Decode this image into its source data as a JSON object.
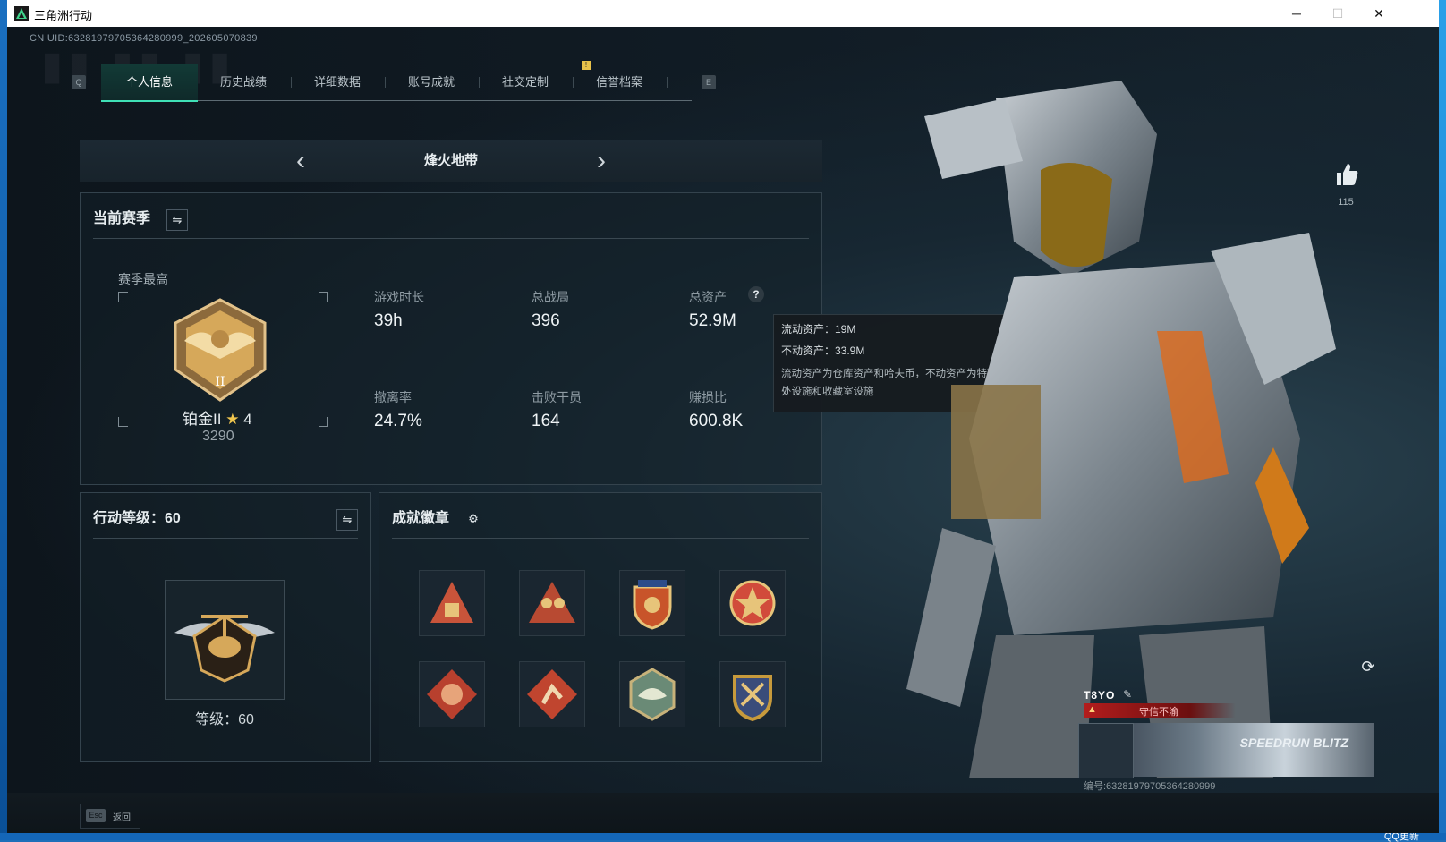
{
  "window": {
    "title": "三角洲行动",
    "controls": {
      "minimize": "─",
      "maximize": "☐",
      "close": "✕"
    }
  },
  "taskbar": {
    "item": "QQ更新"
  },
  "header": {
    "uid": "CN UID:63281979705364280999_202605070839",
    "key_left": "Q",
    "key_right": "E",
    "notif": "!"
  },
  "tabs": [
    {
      "label": "个人信息",
      "active": true
    },
    {
      "label": "历史战绩",
      "active": false
    },
    {
      "label": "详细数据",
      "active": false
    },
    {
      "label": "账号成就",
      "active": false
    },
    {
      "label": "社交定制",
      "active": false
    },
    {
      "label": "信誉档案",
      "active": false
    }
  ],
  "mode_selector": {
    "title": "烽火地带",
    "prev": "‹",
    "next": "›"
  },
  "season": {
    "heading": "当前赛季",
    "swap_icon": "⇋",
    "best_label": "赛季最高",
    "rank_name": "铂金II",
    "rank_star": "★",
    "rank_stars_count": "4",
    "rank_score": "3290",
    "stats": [
      {
        "label": "游戏时长",
        "value": "39h"
      },
      {
        "label": "总战局",
        "value": "396"
      },
      {
        "label": "总资产",
        "value": "52.9M",
        "help": "?"
      },
      {
        "label": "撤离率",
        "value": "24.7%"
      },
      {
        "label": "击败干员",
        "value": "164"
      },
      {
        "label": "赚损比",
        "value": "600.8K"
      }
    ]
  },
  "asset_tooltip": {
    "liquid": "流动资产：19M",
    "fixed": "不动资产：33.9M",
    "desc": "流动资产为仓库资产和哈夫币，不动资产为特勤处设施和收藏室设施"
  },
  "operation_level": {
    "heading": "行动等级：60",
    "swap_icon": "⇋",
    "level_label": "等级：60"
  },
  "achievements": {
    "heading": "成就徽章",
    "gear_icon": "⚙",
    "badges": [
      {
        "icon": "triangle-badge-icon",
        "color": "#c8543a"
      },
      {
        "icon": "soldiers-badge-icon",
        "color": "#c8543a"
      },
      {
        "icon": "shield-badge-icon",
        "color": "#c8542a"
      },
      {
        "icon": "star-badge-icon",
        "color": "#d14b3b"
      },
      {
        "icon": "dragon-badge-icon",
        "color": "#b8402e"
      },
      {
        "icon": "runner-badge-icon",
        "color": "#c0452f"
      },
      {
        "icon": "eagle-badge-icon",
        "color": "#6a8a76"
      },
      {
        "icon": "swords-badge-icon",
        "color": "#c79a3c"
      }
    ]
  },
  "profile": {
    "likes": "115",
    "name": "T8YO",
    "honor": "守信不渝",
    "banner_text": "SPEEDRUN BLITZ",
    "card_id": "编号:63281979705364280999",
    "refresh_icon": "⟳"
  },
  "footer": {
    "esc_key": "Esc",
    "esc_label": "返回"
  },
  "colors": {
    "accent": "#3fe0b6",
    "panel_border": "#34434d",
    "gold": "#d6a85a",
    "honor_red": "#b31d1d"
  }
}
